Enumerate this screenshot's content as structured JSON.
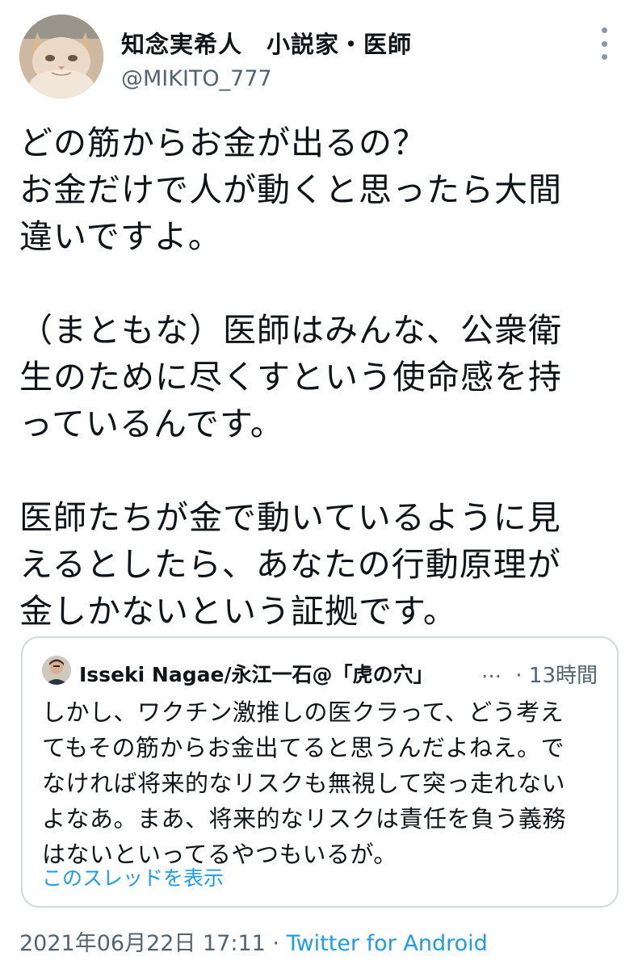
{
  "author": {
    "display_name": "知念実希人　小説家・医師",
    "handle": "@MIKITO_777"
  },
  "tweet": {
    "paragraphs": [
      [
        "どの筋からお金が出るの？",
        "お金だけで人が動くと思ったら大間",
        "違いですよ。"
      ],
      [
        "（まともな）医師はみんな、公衆衛",
        "生のために尽くすという使命感を持",
        "っているんです。"
      ],
      [
        "医師たちが金で動いているように見",
        "えるとしたら、あなたの行動原理が",
        "金しかないという証拠です。"
      ]
    ]
  },
  "quoted": {
    "author": "Isseki Nagae/永江一石@「虎の穴」",
    "ellipsis": "…",
    "time": "· 13時間",
    "lines": [
      "しかし、ワクチン激推しの医クラって、どう考え",
      "てもその筋からお金出てると思うんだよねえ。で",
      "なければ将来的なリスクも無視して突っ走れない",
      "よなあ。まあ、将来的なリスクは責任を負う義務",
      "はないといってるやつもいるが。"
    ],
    "show_thread": "このスレッドを表示"
  },
  "footer": {
    "timestamp": "2021年06月22日 17:11",
    "separator": " · ",
    "source": "Twitter for Android"
  },
  "icons": {
    "avatar": "cat-avatar-icon",
    "quoted_avatar": "person-avatar-icon",
    "more": "more-vertical-icon"
  },
  "colors": {
    "link": "#1d9bf0",
    "secondary_text": "#536471",
    "border": "#cfd9de"
  }
}
